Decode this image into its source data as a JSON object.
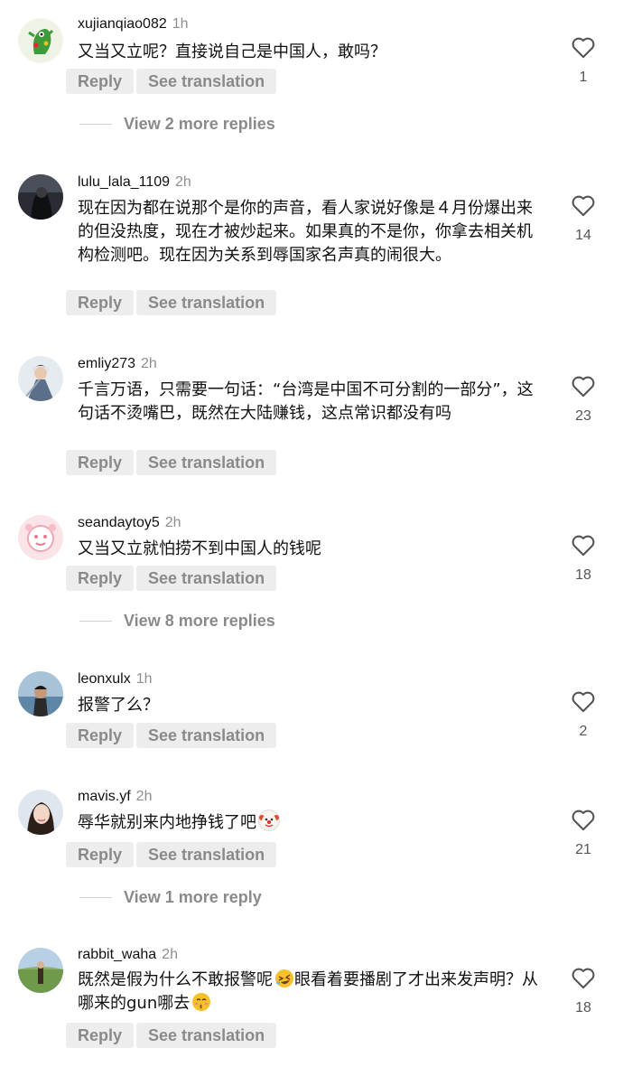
{
  "comments": [
    {
      "username": "xujianqiao082",
      "time": "1h",
      "text": "又当又立呢？直接说自己是中国人，敢吗？",
      "likes": "1",
      "avatar": "green-cartoon-avatar"
    },
    {
      "username": "lulu_lala_1109",
      "time": "2h",
      "text": "现在因为都在说那个是你的声音，看人家说好像是４月份爆出来的但没热度，现在才被炒起来。如果真的不是你，你拿去相关机构检测吧。现在因为关系到辱国家名声真的闹很大。",
      "likes": "14",
      "avatar": "dark-photo-avatar"
    },
    {
      "username": "emliy273",
      "time": "2h",
      "text": "千言万语，只需要一句话：“台湾是中国不可分割的一部分”，这句话不烫嘴巴，既然在大陆赚钱，这点常识都没有吗",
      "likes": "23",
      "avatar": "costume-figure-avatar"
    },
    {
      "username": "seandaytoy5",
      "time": "2h",
      "text": "又当又立就怕捞不到中国人的钱呢",
      "likes": "18",
      "avatar": "pink-illustration-avatar"
    },
    {
      "username": "leonxulx",
      "time": "1h",
      "text": "报警了么？",
      "likes": "2",
      "avatar": "person-sea-avatar"
    },
    {
      "username": "mavis.yf",
      "time": "2h",
      "text": "辱华就别来内地挣钱了吧",
      "likes": "21",
      "avatar": "selfie-avatar",
      "emoji": "clown-face"
    },
    {
      "username": "rabbit_waha",
      "time": "2h",
      "text": "既然是假为什么不敢报警呢",
      "text_mid": "眼看着要播剧了才出来发声明？从哪来的gun哪去",
      "likes": "18",
      "avatar": "meadow-person-avatar",
      "emoji1": "rolling-laughing-face",
      "emoji2": "kissing-face"
    }
  ],
  "reply_label": "Reply",
  "translate_label": "See translation",
  "view_more": [
    {
      "text": "View 2 more replies"
    },
    {
      "text": "View 8 more replies"
    },
    {
      "text": "View 1 more reply"
    }
  ],
  "icons": {
    "like": "heart-outline-icon"
  },
  "colors": {
    "pill_bg": "#ededed",
    "pill_text": "#8a8a8a",
    "muted": "#8e8e8e"
  }
}
